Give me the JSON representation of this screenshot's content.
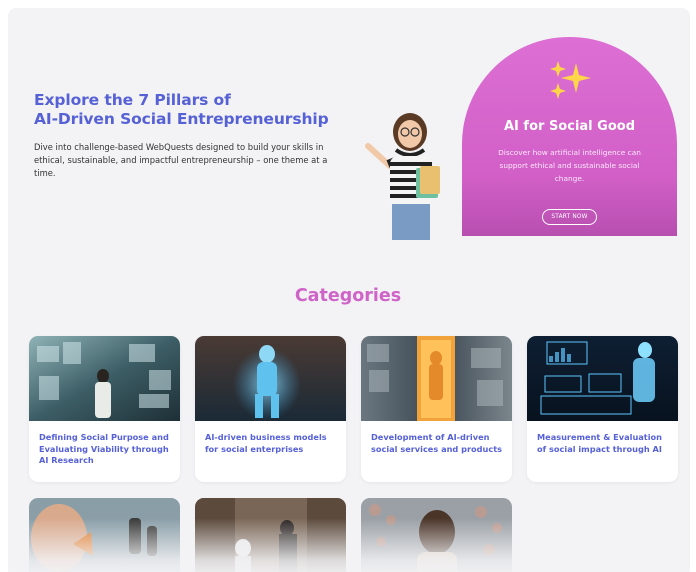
{
  "hero": {
    "title_line1": "Explore the 7 Pillars of",
    "title_line2": "AI-Driven Social Entrepreneurship",
    "description": "Dive into challenge-based WebQuests designed to build your skills in ethical, sustainable, and impactful entrepreneurship – one theme at a time."
  },
  "feature": {
    "title": "AI for Social Good",
    "description": "Discover how artificial intelligence can support ethical and sustainable social change.",
    "button_label": "START NOW"
  },
  "categories": {
    "heading": "Categories",
    "cards": [
      {
        "title": "Defining Social Purpose and Evaluating Viability through AI Research"
      },
      {
        "title": "AI-driven business models for social enterprises"
      },
      {
        "title": "Development of AI-driven social services and products"
      },
      {
        "title": "Measurement & Evaluation of social impact through AI"
      }
    ]
  },
  "colors": {
    "heading_blue": "#5661d6",
    "accent_pink": "#cf63c8",
    "panel_bg": "#f3f3f5"
  }
}
